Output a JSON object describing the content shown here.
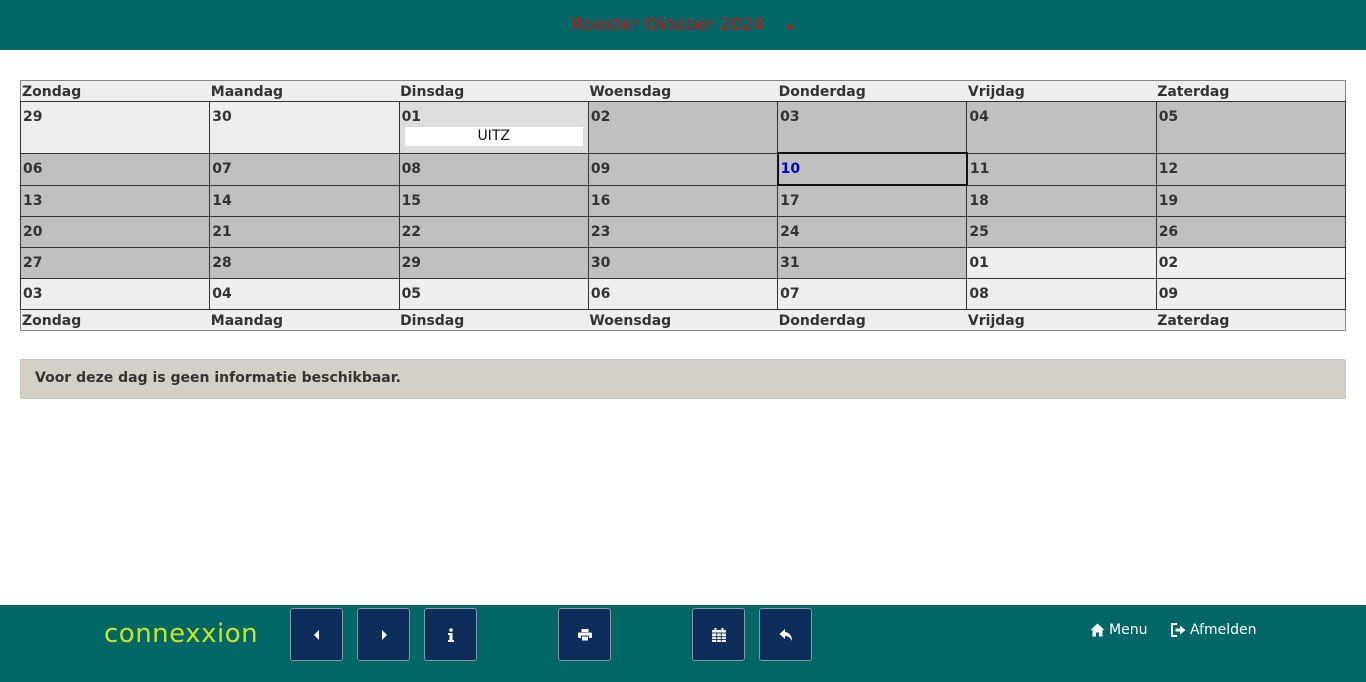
{
  "header": {
    "title": "Rooster Oktober 2024"
  },
  "weekdays": [
    "Zondag",
    "Maandag",
    "Dinsdag",
    "Woensdag",
    "Donderdag",
    "Vrijdag",
    "Zaterdag"
  ],
  "weeks": [
    [
      "29",
      "30",
      "01",
      "02",
      "03",
      "04",
      "05"
    ],
    [
      "06",
      "07",
      "08",
      "09",
      "10",
      "11",
      "12"
    ],
    [
      "13",
      "14",
      "15",
      "16",
      "17",
      "18",
      "19"
    ],
    [
      "20",
      "21",
      "22",
      "23",
      "24",
      "25",
      "26"
    ],
    [
      "27",
      "28",
      "29",
      "30",
      "31",
      "01",
      "02"
    ],
    [
      "03",
      "04",
      "05",
      "06",
      "07",
      "08",
      "09"
    ]
  ],
  "event": {
    "label": "UITZ"
  },
  "info": {
    "message": "Voor deze dag is geen informatie beschikbaar."
  },
  "footer": {
    "logo": "connexxion",
    "menu_label": "Menu",
    "logout_label": "Afmelden"
  },
  "colors": {
    "bar": "#006666",
    "title": "#cc1111",
    "current_month_cell": "#c0c0c0",
    "other_month_cell": "#eeeeee",
    "today_text": "#0000cc",
    "button": "#0d2d5a",
    "logo": "#c8e620"
  },
  "icons": {
    "prev": "caret-left-icon",
    "next": "caret-right-icon",
    "info": "info-icon",
    "print": "print-icon",
    "calendar": "calendar-icon",
    "back": "reply-icon",
    "home": "home-icon",
    "logout": "sign-out-icon"
  }
}
